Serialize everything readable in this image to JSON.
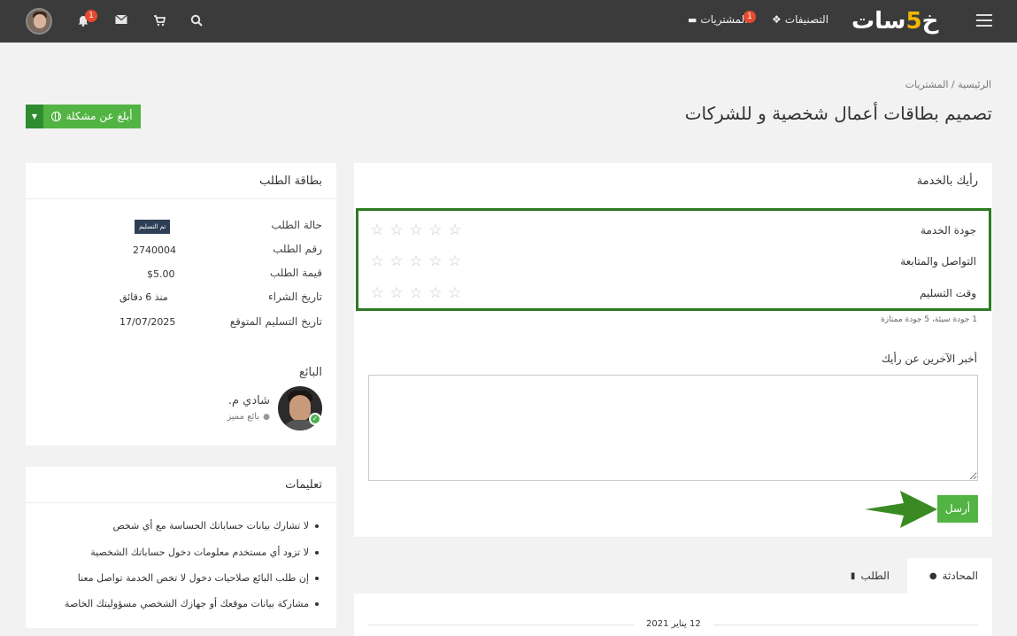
{
  "topbar": {
    "logo_text": "خمسات",
    "logo_digit": "5",
    "categories_label": "التصنيفات",
    "purchases_label": "المشتريات",
    "purchases_badge": "1",
    "notifications_badge": "1"
  },
  "breadcrumb": {
    "home": "الرئيسية",
    "separator": "/",
    "current": "المشتريات"
  },
  "page_title": "تصميم بطاقات أعمال شخصية و للشركات",
  "report_button": "أبلغ عن مشكلة",
  "order_card": {
    "title": "بطاقة الطلب",
    "rows": [
      {
        "label": "حالة الطلب",
        "value": "تم التسليم"
      },
      {
        "label": "رقم الطلب",
        "value": "2740004"
      },
      {
        "label": "قيمة الطلب",
        "value": "$5.00"
      },
      {
        "label": "تاريخ الشراء",
        "value": "منذ 6 دقائق"
      },
      {
        "label": "تاريخ التسليم المتوقع",
        "value": "17/07/2025"
      }
    ],
    "seller_heading": "البائع",
    "seller_name": "شادي م.",
    "seller_level": "بائع مميز"
  },
  "instructions": {
    "title": "تعليمات",
    "items": [
      "لا تشارك بيانات حساباتك الحساسة مع أي شخص",
      "لا تزود أي مستخدم معلومات دخول حساباتك الشخصية",
      "إن طلب البائع صلاحيات دخول لا تخص الخدمة تواصل معنا",
      "مشاركة بيانات موقعك أو جهازك الشخصي مسؤوليتك الخاصة"
    ]
  },
  "review": {
    "title": "رأيك بالخدمة",
    "criteria": [
      {
        "label": "جودة الخدمة",
        "stars": 0
      },
      {
        "label": "التواصل والمتابعة",
        "stars": 0
      },
      {
        "label": "وقت التسليم",
        "stars": 0
      }
    ],
    "hint": "1 جودة سيئة، 5 جودة ممتازة",
    "comment_label": "أخبر الآخرين عن رأيك",
    "comment_value": "",
    "send_label": "أرسل"
  },
  "tabs": {
    "conversation": "المحادثة",
    "order": "الطلب"
  },
  "conversation": {
    "date": "12 يناير 2021"
  },
  "colors": {
    "topbar": "#3b3b3b",
    "accent_green": "#52b442",
    "highlight_border": "#2d7a22",
    "badge": "#e54b2f"
  }
}
